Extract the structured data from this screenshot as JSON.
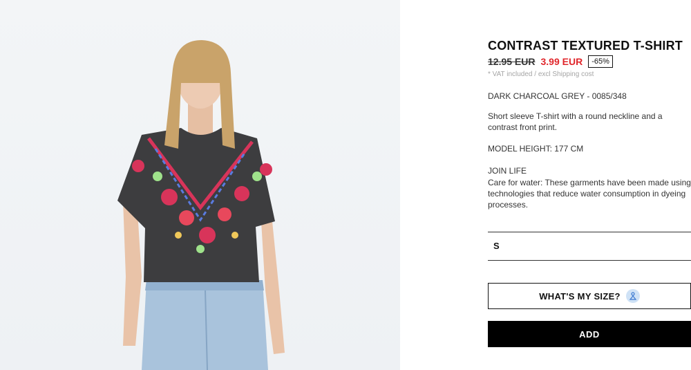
{
  "product": {
    "title": "CONTRAST TEXTURED T-SHIRT",
    "old_price": "12.95 EUR",
    "new_price": "3.99 EUR",
    "discount": "-65%",
    "vat_note": "* VAT included / excl Shipping cost",
    "color_ref": "DARK CHARCOAL GREY - 0085/348",
    "description": "Short sleeve T-shirt with a round neckline and a contrast front print.",
    "model_height": "MODEL HEIGHT: 177 CM",
    "join_life": "JOIN LIFE",
    "care": "Care for water: These garments have been made using technologies that reduce water consumption in dyeing processes."
  },
  "size_selector": {
    "selected": "S"
  },
  "buttons": {
    "whats_my_size": "WHAT'S MY SIZE?",
    "add": "ADD"
  },
  "icons": {
    "size_assistant": "hanger-person-icon"
  },
  "colors": {
    "sale_red": "#e0262b",
    "add_button_bg": "#000000",
    "size_icon_bg": "#cfe2f6"
  }
}
